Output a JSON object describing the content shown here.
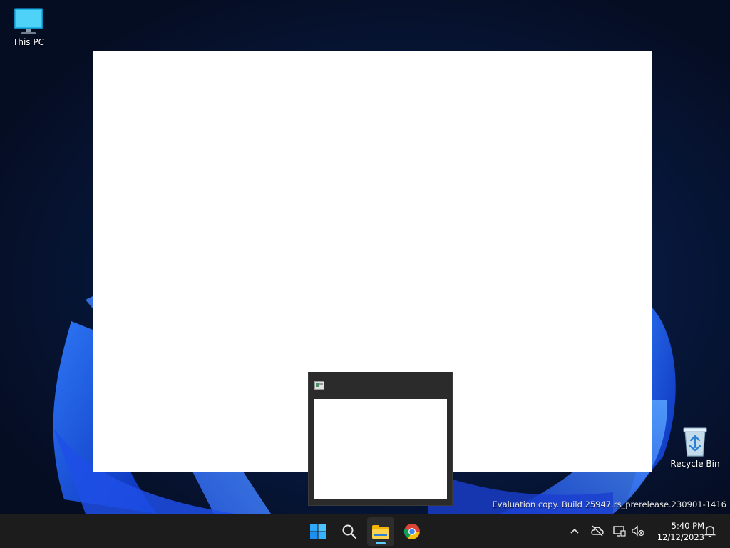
{
  "desktop": {
    "icons": [
      {
        "label": "This PC"
      },
      {
        "label": "Recycle Bin"
      }
    ],
    "watermark": "Evaluation copy. Build 25947.rs_prerelease.230901-1416"
  },
  "taskbar": {
    "apps": [
      "start",
      "search",
      "file-explorer",
      "chrome"
    ],
    "clock": {
      "time": "5:40 PM",
      "date": "12/12/2023"
    }
  },
  "colors": {
    "accent": "#60cdff",
    "taskbar": "#1c1c1c"
  }
}
